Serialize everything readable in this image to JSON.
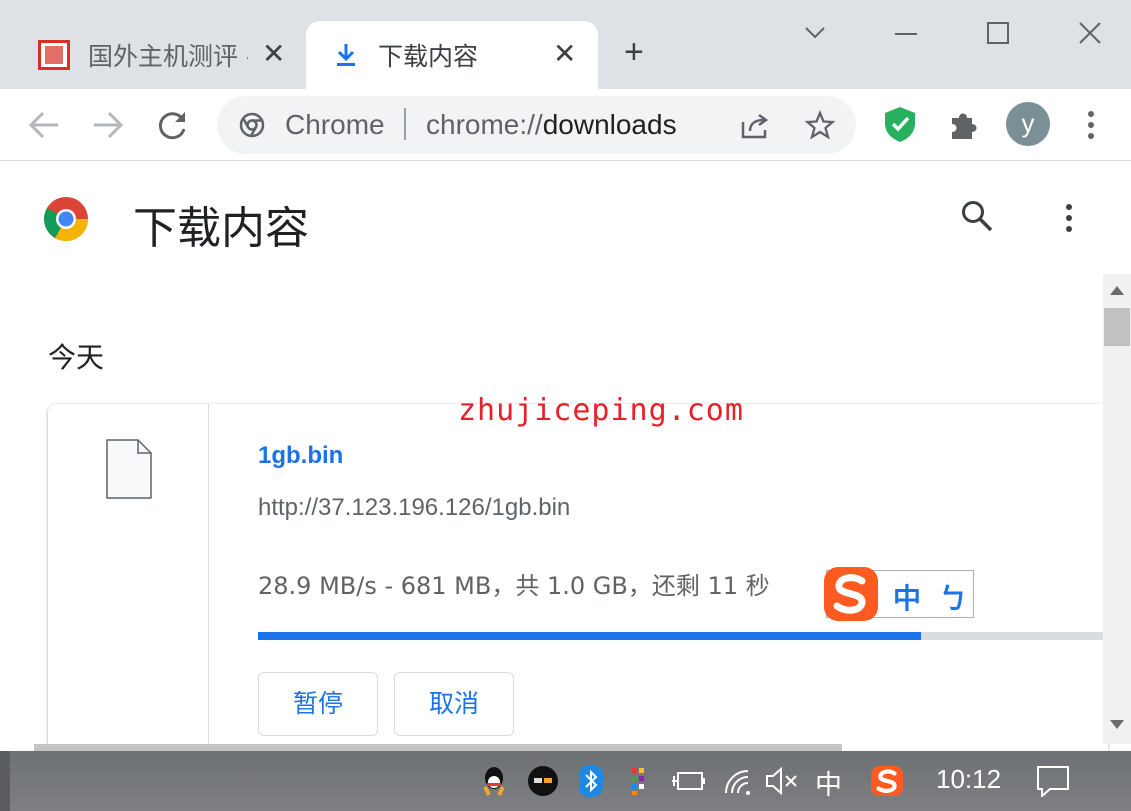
{
  "tabs": [
    {
      "title": "国外主机测评 - ",
      "close": "✕"
    },
    {
      "title": "下载内容",
      "close": "✕"
    }
  ],
  "new_tab": "+",
  "omnibox": {
    "site_label": "Chrome",
    "url_scheme": "chrome://",
    "url_host": "downloads"
  },
  "avatar_letter": "y",
  "page": {
    "title": "下载内容",
    "section_today": "今天"
  },
  "download": {
    "file_name": "1gb.bin",
    "url": "http://37.123.196.126/1gb.bin",
    "status": "28.9 MB/s - 681 MB，共 1.0 GB，还剩 11 秒",
    "progress_percent": 78,
    "pause_label": "暂停",
    "cancel_label": "取消"
  },
  "watermark": "zhujiceping.com",
  "ime": {
    "mode": "中",
    "punct": "ㄅ"
  },
  "taskbar": {
    "ime_indicator": "中",
    "clock": "10:12"
  },
  "colors": {
    "accent": "#1a73e8",
    "tabstrip": "#dee1e6",
    "taskbar": "#7d7f82",
    "watermark": "#e8202a",
    "ime_logo": "#ff5a1f"
  },
  "icons": [
    "download-icon",
    "back-icon",
    "forward-icon",
    "reload-icon",
    "chrome-icon",
    "share-icon",
    "star-icon",
    "shield-icon",
    "puzzle-icon",
    "kebab-menu-icon",
    "search-icon",
    "file-icon",
    "qq-icon",
    "bluetooth-icon",
    "power-icon",
    "wifi-icon",
    "volume-mute-icon",
    "notification-icon"
  ]
}
